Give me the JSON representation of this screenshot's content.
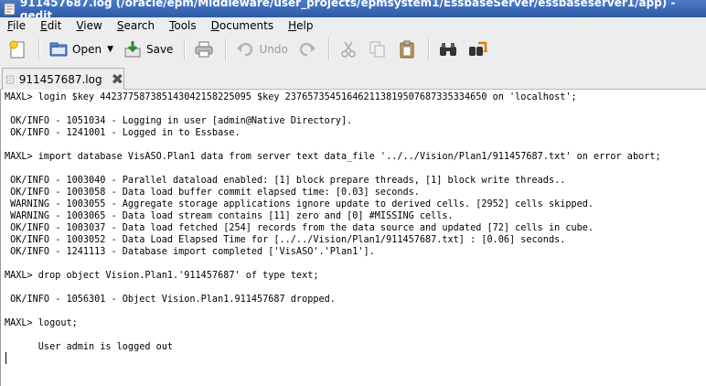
{
  "window": {
    "title": "911457687.log (/oracle/epm/Middleware/user_projects/epmsystem1/EssbaseServer/essbaseserver1/app) - gedit"
  },
  "menu": [
    {
      "label": "File",
      "key": "F"
    },
    {
      "label": "Edit",
      "key": "E"
    },
    {
      "label": "View",
      "key": "V"
    },
    {
      "label": "Search",
      "key": "S"
    },
    {
      "label": "Tools",
      "key": "T"
    },
    {
      "label": "Documents",
      "key": "D"
    },
    {
      "label": "Help",
      "key": "H"
    }
  ],
  "toolbar": {
    "open_label": "Open",
    "save_label": "Save",
    "undo_label": "Undo"
  },
  "tab": {
    "label": "911457687.log",
    "close_glyph": "✖"
  },
  "editor": {
    "lines": [
      "MAXL> login $key 4423775873851430421582250​95 $key 237657354516462113819507687335334650 on 'localhost';",
      "",
      " OK/INFO - 1051034 - Logging in user [admin@Native Directory].",
      " OK/INFO - 1241001 - Logged in to Essbase.",
      "",
      "MAXL> import database VisASO.Plan1 data from server text data_file '../../Vision/Plan1/911457687.txt' on error abort;",
      "",
      " OK/INFO - 1003040 - Parallel dataload enabled: [1] block prepare threads, [1] block write threads..",
      " OK/INFO - 1003058 - Data load buffer commit elapsed time: [0.03] seconds.",
      " WARNING - 1003055 - Aggregate storage applications ignore update to derived cells. [2952] cells skipped.",
      " WARNING - 1003065 - Data load stream contains [11] zero and [0] #MISSING cells.",
      " OK/INFO - 1003037 - Data load fetched [254] records from the data source and updated [72] cells in cube.",
      " OK/INFO - 1003052 - Data Load Elapsed Time for [../../Vision/Plan1/911457687.txt] : [0.06] seconds.",
      " OK/INFO - 1241113 - Database import completed ['VisASO'.'Plan1'].",
      "",
      "MAXL> drop object Vision.Plan1.'911457687' of type text;",
      "",
      " OK/INFO - 1056301 - Object Vision.Plan1.911457687 dropped.",
      "",
      "MAXL> logout;",
      "",
      "      User admin is logged out",
      ""
    ]
  }
}
